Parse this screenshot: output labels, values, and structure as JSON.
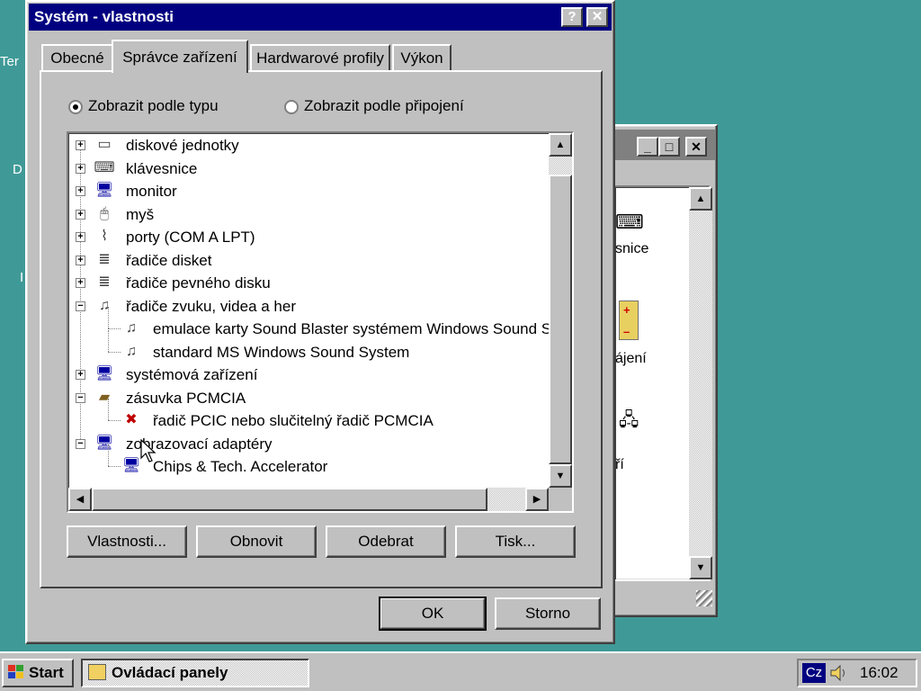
{
  "desktop": {
    "fragments": [
      "Ter",
      "D",
      "I"
    ]
  },
  "background_window": {
    "buttons": [
      "_",
      "□",
      "✕"
    ],
    "visible_texts": [
      "snice",
      "ájení",
      "ří"
    ]
  },
  "dialog": {
    "title": "Systém - vlastnosti",
    "help_glyph": "?",
    "close_glyph": "✕",
    "tabs": [
      {
        "label": "Obecné"
      },
      {
        "label": "Správce zařízení",
        "active": true
      },
      {
        "label": "Hardwarové profily"
      },
      {
        "label": "Výkon"
      }
    ],
    "view_by_type": "Zobrazit podle typu",
    "view_by_connection": "Zobrazit podle připojení",
    "selected_view": "type",
    "tree": [
      {
        "label": "diskové jednotky",
        "icon": "disk-drive-icon",
        "level": 0,
        "state": "collapsed"
      },
      {
        "label": "klávesnice",
        "icon": "keyboard-icon",
        "level": 0,
        "state": "collapsed"
      },
      {
        "label": "monitor",
        "icon": "monitor-icon",
        "level": 0,
        "state": "collapsed"
      },
      {
        "label": "myš",
        "icon": "mouse-icon",
        "level": 0,
        "state": "collapsed"
      },
      {
        "label": "porty (COM A LPT)",
        "icon": "port-icon",
        "level": 0,
        "state": "collapsed"
      },
      {
        "label": "řadiče disket",
        "icon": "floppy-controller-icon",
        "level": 0,
        "state": "collapsed"
      },
      {
        "label": "řadiče pevného disku",
        "icon": "hard-disk-controller-icon",
        "level": 0,
        "state": "collapsed"
      },
      {
        "label": "řadiče zvuku, videa a her",
        "icon": "sound-video-game-icon",
        "level": 0,
        "state": "expanded"
      },
      {
        "label": "emulace karty Sound Blaster systémem Windows Sound S",
        "icon": "sound-card-icon",
        "level": 1
      },
      {
        "label": "standard MS Windows Sound System",
        "icon": "sound-card-icon",
        "level": 1
      },
      {
        "label": "systémová zařízení",
        "icon": "system-device-icon",
        "level": 0,
        "state": "collapsed"
      },
      {
        "label": "zásuvka PCMCIA",
        "icon": "pcmcia-icon",
        "level": 0,
        "state": "expanded"
      },
      {
        "label": "řadič PCIC nebo slučitelný řadič PCMCIA",
        "icon": "pcmcia-controller-error-icon",
        "level": 1
      },
      {
        "label": "zobrazovací adaptéry",
        "icon": "display-adapter-icon",
        "level": 0,
        "state": "expanded"
      },
      {
        "label": "Chips & Tech. Accelerator",
        "icon": "display-adapter-icon",
        "level": 1
      }
    ],
    "scroll_glyphs": {
      "up": "▲",
      "down": "▼",
      "left": "◀",
      "right": "▶"
    },
    "buttons": {
      "properties": "Vlastnosti...",
      "refresh": "Obnovit",
      "remove": "Odebrat",
      "print": "Tisk..."
    },
    "ok": "OK",
    "cancel": "Storno"
  },
  "taskbar": {
    "start": "Start",
    "task": "Ovládací panely",
    "language": "Cz",
    "clock": "16:02"
  },
  "colors": {
    "desktop": "#3f9a97",
    "titlebar_active": "#000080",
    "face": "#c0c0c0"
  }
}
